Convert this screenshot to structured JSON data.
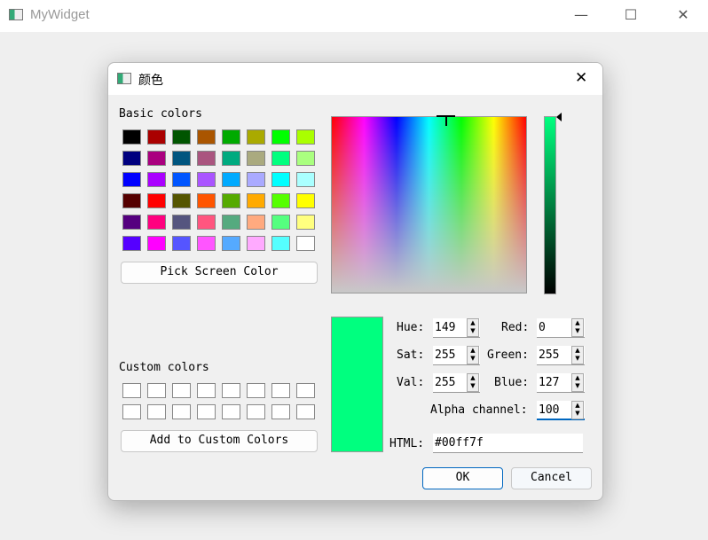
{
  "app": {
    "title": "MyWidget",
    "minimize": "—",
    "maximize": "☐",
    "close": "✕"
  },
  "dialog": {
    "title": "颜色",
    "close": "✕",
    "basic_label": "Basic colors",
    "basic_colors": [
      [
        "#000000",
        "#aa0000",
        "#005500",
        "#aa5500",
        "#00aa00",
        "#aaaa00",
        "#00ff00",
        "#aaff00"
      ],
      [
        "#00007f",
        "#aa007f",
        "#00557f",
        "#aa557f",
        "#00aa7f",
        "#aaaa7f",
        "#00ff7f",
        "#aaff7f"
      ],
      [
        "#0000ff",
        "#aa00ff",
        "#0055ff",
        "#aa55ff",
        "#00aaff",
        "#aaaaff",
        "#00ffff",
        "#aaffff"
      ],
      [
        "#550000",
        "#ff0000",
        "#555500",
        "#ff5500",
        "#55aa00",
        "#ffaa00",
        "#55ff00",
        "#ffff00"
      ],
      [
        "#55007f",
        "#ff007f",
        "#55557f",
        "#ff557f",
        "#55aa7f",
        "#ffaa7f",
        "#55ff7f",
        "#ffff7f"
      ],
      [
        "#5500ff",
        "#ff00ff",
        "#5555ff",
        "#ff55ff",
        "#55aaff",
        "#ffaaff",
        "#55ffff",
        "#ffffff"
      ]
    ],
    "pick_screen": "Pick Screen Color",
    "custom_label": "Custom colors",
    "add_custom": "Add to Custom Colors",
    "current_color": "#00ff7f",
    "fields": {
      "hue_label": "Hue:",
      "hue": "149",
      "sat_label": "Sat:",
      "sat": "255",
      "val_label": "Val:",
      "val": "255",
      "red_label": "Red:",
      "red": "0",
      "green_label": "Green:",
      "green": "255",
      "blue_label": "Blue:",
      "blue": "127",
      "alpha_label": "Alpha channel:",
      "alpha": "100",
      "html_label": "HTML:",
      "html": "#00ff7f"
    },
    "ok": "OK",
    "cancel": "Cancel"
  }
}
